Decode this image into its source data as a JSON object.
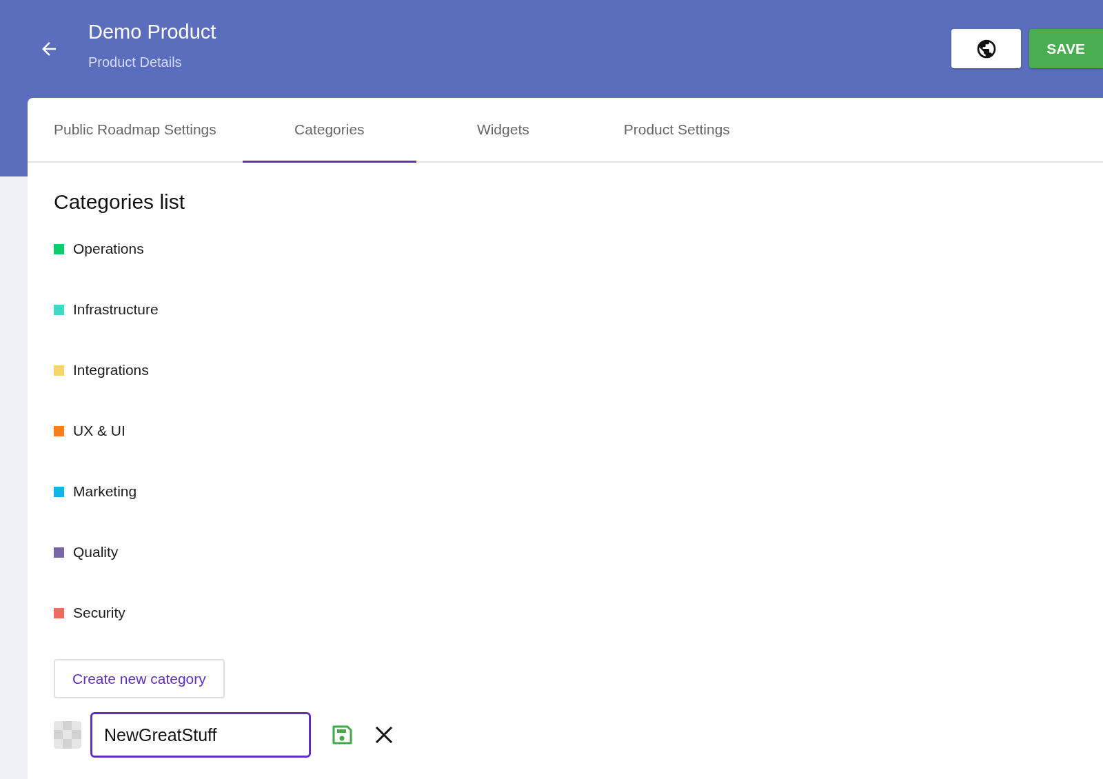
{
  "header": {
    "title": "Demo Product",
    "subtitle": "Product Details",
    "save_button": "SAVE"
  },
  "tabs": [
    {
      "label": "Public Roadmap Settings",
      "selected": false
    },
    {
      "label": "Categories",
      "selected": true
    },
    {
      "label": "Widgets",
      "selected": false
    },
    {
      "label": "Product Settings",
      "selected": false
    }
  ],
  "categories_list": {
    "title": "Categories list",
    "items": [
      {
        "name": "Operations",
        "color": "#0fcc6a"
      },
      {
        "name": "Infrastructure",
        "color": "#3fd9c5"
      },
      {
        "name": "Integrations",
        "color": "#f7d46a"
      },
      {
        "name": "UX & UI",
        "color": "#f77f1b"
      },
      {
        "name": "Marketing",
        "color": "#12b3e8"
      },
      {
        "name": "Quality",
        "color": "#7468a6"
      },
      {
        "name": "Security",
        "color": "#ec6d5f"
      }
    ],
    "create_button": "Create new category",
    "new_category": {
      "value": "NewGreatStuff"
    }
  }
}
